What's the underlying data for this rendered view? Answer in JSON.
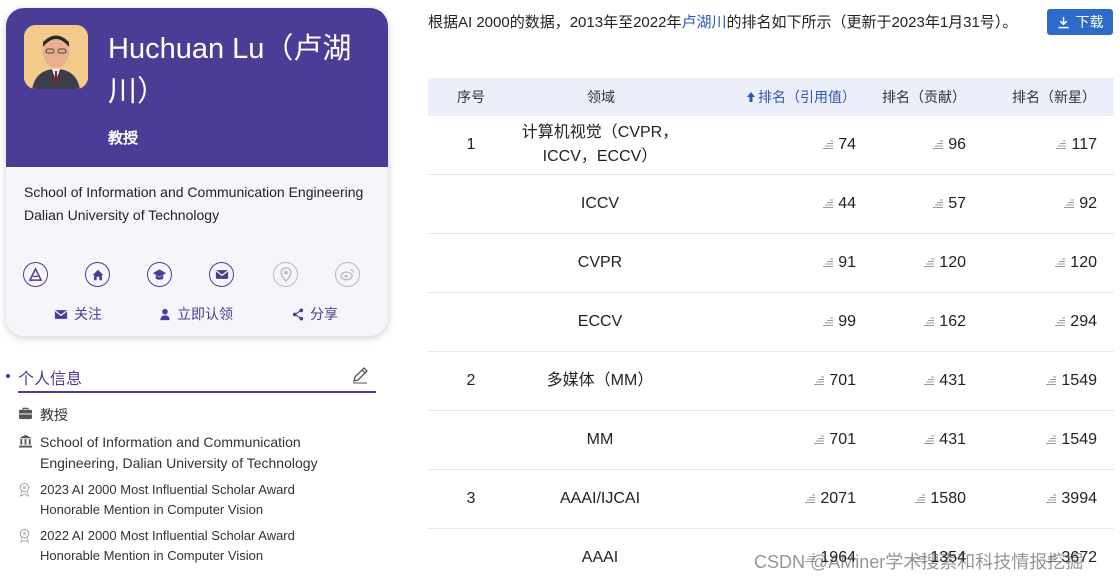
{
  "profile": {
    "name": "Huchuan Lu（卢湖川）",
    "title": "教授",
    "affiliation": [
      "School of Information and Communication Engineering",
      "Dalian University of Technology"
    ],
    "icons": [
      "aminer-icon",
      "home-icon",
      "scholar-icon",
      "email-icon",
      "location-icon",
      "weibo-icon"
    ],
    "actions": {
      "follow": "关注",
      "claim": "立即认领",
      "share": "分享"
    },
    "accent": "#4b3d95"
  },
  "personal_info": {
    "heading": "个人信息",
    "position": "教授",
    "organization": "School of Information and Communication Engineering, Dalian University of Technology",
    "awards": [
      "2023 AI 2000 Most Influential Scholar Award Honorable Mention in Computer Vision",
      "2022 AI 2000 Most Influential Scholar Award Honorable Mention in Computer Vision"
    ]
  },
  "intro": {
    "prefix": "根据AI 2000的数据，2013年至2022年",
    "link": "卢湖川",
    "suffix": "的排名如下所示（更新于2023年1月31号）。"
  },
  "download_label": "下载",
  "table": {
    "headers": {
      "index": "序号",
      "field": "领域",
      "rank_citation": "排名（引用值）",
      "rank_contribution": "排名（贡献）",
      "rank_rising": "排名（新星）"
    },
    "rows": [
      {
        "index": "1",
        "field": "计算机视觉（CVPR，ICCV，ECCV）",
        "r1": "74",
        "r2": "96",
        "r3": "117"
      },
      {
        "index": "",
        "field": "ICCV",
        "r1": "44",
        "r2": "57",
        "r3": "92"
      },
      {
        "index": "",
        "field": "CVPR",
        "r1": "91",
        "r2": "120",
        "r3": "120"
      },
      {
        "index": "",
        "field": "ECCV",
        "r1": "99",
        "r2": "162",
        "r3": "294"
      },
      {
        "index": "2",
        "field": "多媒体（MM）",
        "r1": "701",
        "r2": "431",
        "r3": "1549"
      },
      {
        "index": "",
        "field": "MM",
        "r1": "701",
        "r2": "431",
        "r3": "1549"
      },
      {
        "index": "3",
        "field": "AAAI/IJCAI",
        "r1": "2071",
        "r2": "1580",
        "r3": "3994"
      },
      {
        "index": "",
        "field": "AAAI",
        "r1": "1964",
        "r2": "1354",
        "r3": "3672"
      }
    ]
  },
  "watermark": "CSDN @AMiner学术搜索和科技情报挖掘"
}
